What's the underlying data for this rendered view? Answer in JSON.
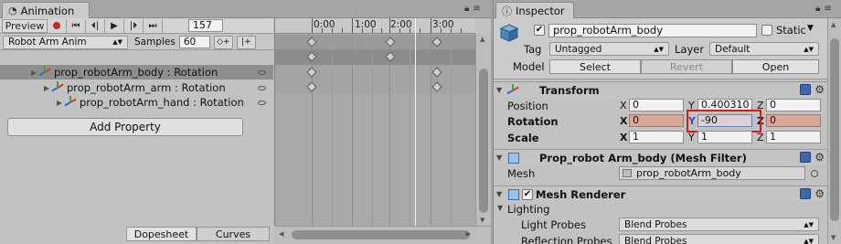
{
  "animation": {
    "tab_title": "Animation",
    "preview_label": "Preview",
    "frame": "157",
    "clip_name": "Robot Arm Anim",
    "samples_label": "Samples",
    "samples_value": "60",
    "properties": [
      {
        "label": "prop_robotArm_body : Rotation",
        "selected": true
      },
      {
        "label": "prop_robotArm_arm : Rotation",
        "selected": false
      },
      {
        "label": "prop_robotArm_hand : Rotation",
        "selected": false
      }
    ],
    "add_property_label": "Add Property",
    "timeline": {
      "ticks": [
        "0:00",
        "1:00",
        "2:00",
        "3:00"
      ],
      "playhead_time_sec": 2.62
    },
    "bottom_tabs": [
      "Dopesheet",
      "Curves"
    ],
    "record_color": "#c4282b"
  },
  "inspector": {
    "tab_title": "Inspector",
    "object_name": "prop_robotArm_body",
    "active": true,
    "static_label": "Static",
    "static_checked": false,
    "tag_label": "Tag",
    "tag_value": "Untagged",
    "layer_label": "Layer",
    "layer_value": "Default",
    "model_label": "Model",
    "model_buttons": [
      "Select",
      "Revert",
      "Open"
    ],
    "transform": {
      "title": "Transform",
      "position": {
        "label": "Position",
        "x": "0",
        "y": "0.400310",
        "z": "0"
      },
      "rotation": {
        "label": "Rotation",
        "x": "0",
        "y": "-90",
        "z": "0"
      },
      "scale": {
        "label": "Scale",
        "x": "1",
        "y": "1",
        "z": "1"
      }
    },
    "mesh_filter": {
      "title": "Prop_robot Arm_body (Mesh Filter)",
      "mesh_label": "Mesh",
      "mesh_value": "prop_robotArm_body"
    },
    "mesh_renderer": {
      "title": "Mesh Renderer",
      "enabled": true,
      "lighting_label": "Lighting",
      "light_probes_label": "Light Probes",
      "light_probes_value": "Blend Probes",
      "reflection_probes_label": "Reflection Probes",
      "reflection_probes_value": "Blend Probes"
    },
    "animated_field_color": "#d9a796"
  }
}
